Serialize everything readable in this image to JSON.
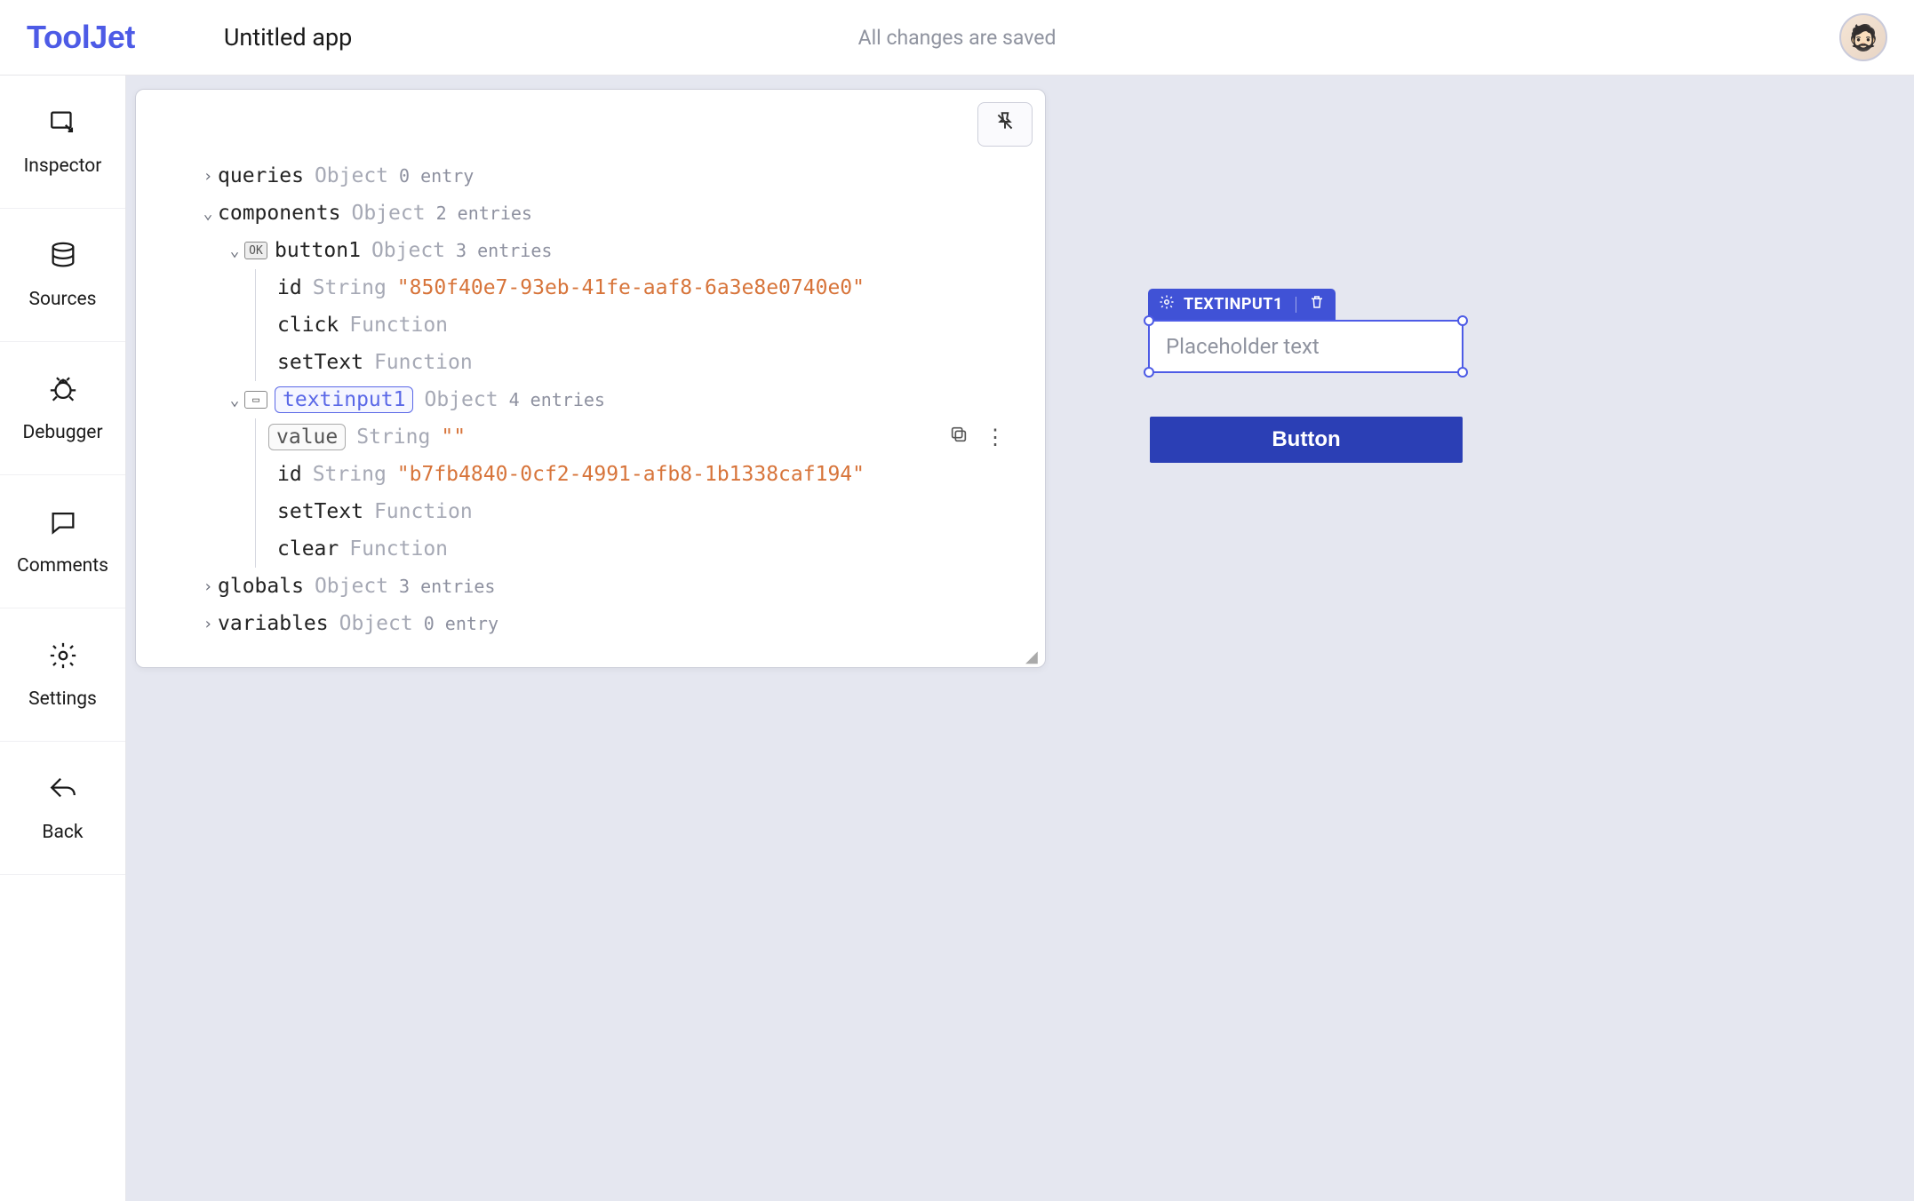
{
  "header": {
    "logo": "ToolJet",
    "app_title": "Untitled app",
    "saved_status": "All changes are saved"
  },
  "sidebar": {
    "items": [
      {
        "label": "Inspector"
      },
      {
        "label": "Sources"
      },
      {
        "label": "Debugger"
      },
      {
        "label": "Comments"
      },
      {
        "label": "Settings"
      },
      {
        "label": "Back"
      }
    ]
  },
  "inspector": {
    "rows": {
      "queries": {
        "key": "queries",
        "type": "Object",
        "count": "0 entry"
      },
      "components": {
        "key": "components",
        "type": "Object",
        "count": "2 entries"
      },
      "button1": {
        "key": "button1",
        "type": "Object",
        "count": "3 entries"
      },
      "button1_id": {
        "key": "id",
        "type": "String",
        "value": "\"850f40e7-93eb-41fe-aaf8-6a3e8e0740e0\""
      },
      "button1_click": {
        "key": "click",
        "type": "Function"
      },
      "button1_setText": {
        "key": "setText",
        "type": "Function"
      },
      "textinput1": {
        "key": "textinput1",
        "type": "Object",
        "count": "4 entries"
      },
      "textinput1_value": {
        "key": "value",
        "type": "String",
        "value": "\"\""
      },
      "textinput1_id": {
        "key": "id",
        "type": "String",
        "value": "\"b7fb4840-0cf2-4991-afb8-1b1338caf194\""
      },
      "textinput1_setText": {
        "key": "setText",
        "type": "Function"
      },
      "textinput1_clear": {
        "key": "clear",
        "type": "Function"
      },
      "globals": {
        "key": "globals",
        "type": "Object",
        "count": "3 entries"
      },
      "variables": {
        "key": "variables",
        "type": "Object",
        "count": "0 entry"
      }
    }
  },
  "canvas": {
    "textinput_label": "TEXTINPUT1",
    "textinput_placeholder": "Placeholder text",
    "button_label": "Button"
  }
}
